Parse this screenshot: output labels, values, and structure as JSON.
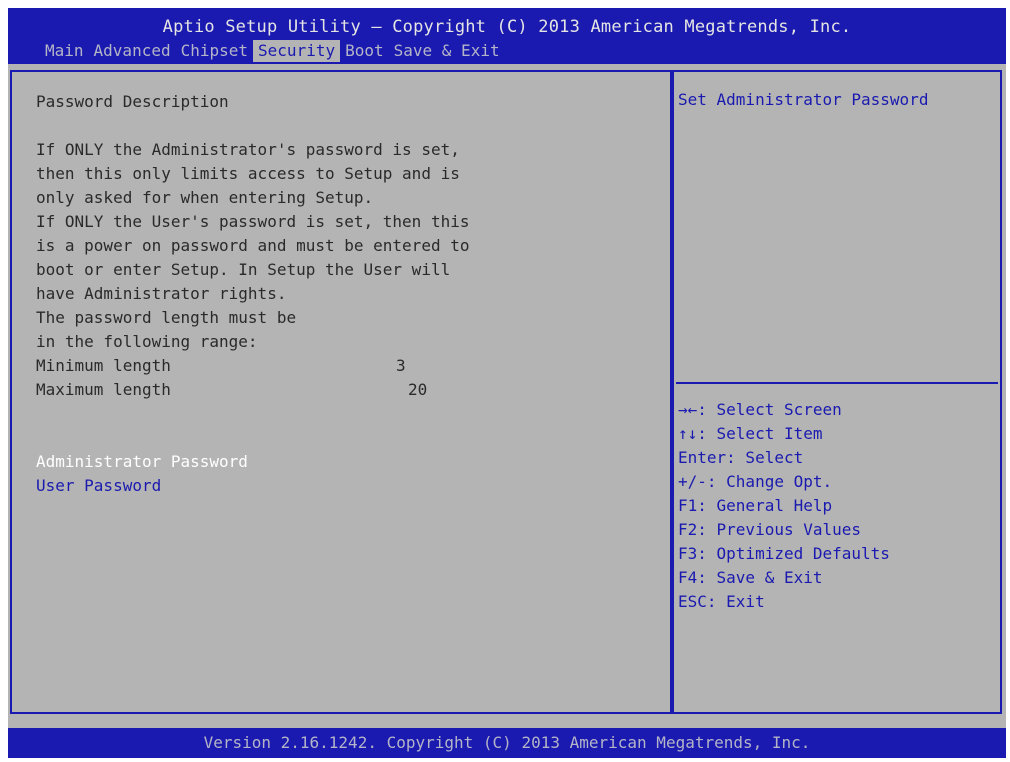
{
  "header": {
    "title": "Aptio Setup Utility – Copyright (C) 2013 American Megatrends, Inc.",
    "tabs": [
      "Main",
      "Advanced",
      "Chipset",
      "Security",
      "Boot",
      "Save & Exit"
    ],
    "active_tab": "Security"
  },
  "main": {
    "description_title": "Password Description",
    "description_lines": [
      "If ONLY the Administrator's password is set,",
      "then this only limits access to Setup and is",
      "only asked for when entering Setup.",
      "If ONLY the User's password is set, then this",
      "is a power on password and must be entered to",
      "boot or enter Setup. In Setup the User will",
      "have Administrator rights.",
      "The password length must be",
      "in the following range:"
    ],
    "min_label": "Minimum length",
    "min_value": "3",
    "max_label": "Maximum length",
    "max_value": "20",
    "items": [
      {
        "label": "Administrator Password",
        "selected": true
      },
      {
        "label": "User Password",
        "selected": false
      }
    ]
  },
  "help": {
    "text": "Set Administrator Password",
    "keys": [
      "→←: Select Screen",
      "↑↓: Select Item",
      "Enter: Select",
      "+/-: Change Opt.",
      "F1: General Help",
      "F2: Previous Values",
      "F3: Optimized Defaults",
      "F4: Save & Exit",
      "ESC: Exit"
    ]
  },
  "footer": {
    "version": "Version 2.16.1242. Copyright (C) 2013 American Megatrends, Inc."
  },
  "colors": {
    "bios_blue": "#1a1ab0",
    "panel_gray": "#b4b4b4",
    "selected_white": "#ffffff"
  }
}
